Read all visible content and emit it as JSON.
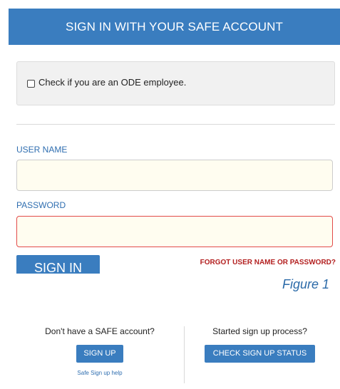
{
  "header": {
    "title": "SIGN IN WITH YOUR SAFE ACCOUNT"
  },
  "employee_option": {
    "checked": false,
    "label": "Check if you are an ODE employee."
  },
  "form": {
    "username_label": "USER NAME",
    "username_value": "",
    "password_label": "PASSWORD",
    "password_value": "",
    "signin_label": "SIGN IN",
    "forgot_label": "FORGOT USER NAME OR PASSWORD?"
  },
  "caption": "Figure 1",
  "signup": {
    "left": {
      "prompt": "Don't have a SAFE account?",
      "button_label": "SIGN UP",
      "help_link": "Safe Sign up help"
    },
    "right": {
      "prompt": "Started sign up process?",
      "button_label": "CHECK SIGN UP STATUS"
    }
  },
  "colors": {
    "brand_blue": "#3a7dbf",
    "label_blue": "#2f6eb0",
    "error_red": "#e24a4a",
    "link_red": "#b32020"
  }
}
